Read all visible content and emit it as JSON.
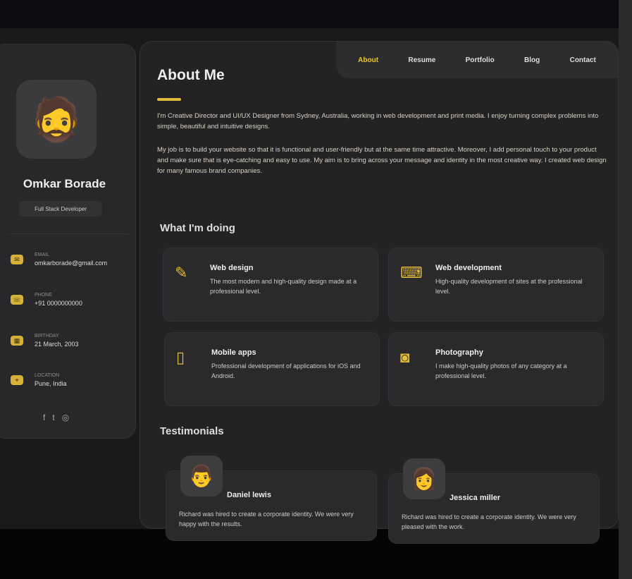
{
  "profile": {
    "avatar_emoji": "🧔",
    "name": "Omkar Borade",
    "title": "Full Stack Developer"
  },
  "contacts": [
    {
      "label": "Email",
      "value": "omkarborade@gmail.com",
      "icon": "mail-icon"
    },
    {
      "label": "Phone",
      "value": "+91 0000000000",
      "icon": "phone-icon"
    },
    {
      "label": "Birthday",
      "value": "21 March, 2003",
      "icon": "calendar-icon"
    },
    {
      "label": "Location",
      "value": "Pune, India",
      "icon": "location-icon"
    }
  ],
  "social": {
    "facebook": "f",
    "twitter": "t",
    "instagram": "◎"
  },
  "nav": [
    "About",
    "Resume",
    "Portfolio",
    "Blog",
    "Contact"
  ],
  "about": {
    "heading": "About Me",
    "p1": "I'm Creative Director and UI/UX Designer from Sydney, Australia, working in web development and print media. I enjoy turning complex problems into simple, beautiful and intuitive designs.",
    "p2": "My job is to build your website so that it is functional and user-friendly but at the same time attractive. Moreover, I add personal touch to your product and make sure that is eye-catching and easy to use. My aim is to bring across your message and identity in the most creative way. I created web design for many famous brand companies."
  },
  "services": {
    "heading": "What I'm doing",
    "items": [
      {
        "title": "Web design",
        "desc": "The most modern and high-quality design made at a professional level.",
        "icon": "✎"
      },
      {
        "title": "Web development",
        "desc": "High-quality development of sites at the professional level.",
        "icon": "⌨"
      },
      {
        "title": "Mobile apps",
        "desc": "Professional development of applications for iOS and Android.",
        "icon": "▯"
      },
      {
        "title": "Photography",
        "desc": "I make high-quality photos of any category at a professional level.",
        "icon": "◙"
      }
    ]
  },
  "testimonials": {
    "heading": "Testimonials",
    "items": [
      {
        "name": "Daniel lewis",
        "text": "Richard was hired to create a corporate identity. We were very happy with the results.",
        "avatar": "👨"
      },
      {
        "name": "Jessica miller",
        "text": "Richard was hired to create a corporate identity. We were very pleased with the work.",
        "avatar": "👩"
      }
    ]
  }
}
